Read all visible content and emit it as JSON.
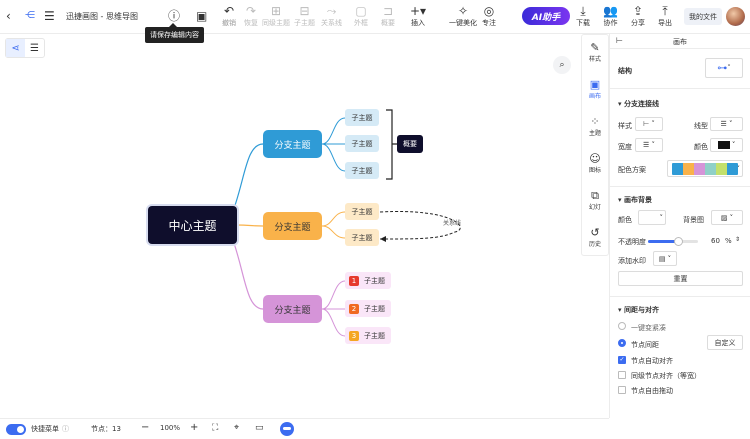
{
  "title": "迅捷画图 - 思维导图",
  "tooltip": "请保存编辑内容",
  "toolbar": {
    "undo": "撤销",
    "redo": "恢复",
    "sibling": "同级主题",
    "child": "子主题",
    "relation": "关系线",
    "frame": "外框",
    "summary": "概要",
    "insert": "插入",
    "beautify": "一键美化",
    "focus": "专注",
    "ai": "AI助手",
    "download": "下载",
    "collab": "协作",
    "share": "分享",
    "export": "导出",
    "my_files": "我的文件"
  },
  "mindmap": {
    "center": "中心主题",
    "branches": [
      {
        "label": "分支主题",
        "color": "#2f9bd6",
        "children": [
          "子主题",
          "子主题",
          "子主题"
        ]
      },
      {
        "label": "分支主题",
        "color": "#f9b24a",
        "children": [
          "子主题",
          "子主题"
        ]
      },
      {
        "label": "分支主题",
        "color": "#d594d8",
        "children": [
          "子主题",
          "子主题",
          "子主题"
        ]
      }
    ],
    "summary": "概要",
    "relation_label": "关系线",
    "numbers": [
      "1",
      "2",
      "3"
    ],
    "number_colors": [
      "#e63a2e",
      "#f06a22",
      "#f5a623"
    ]
  },
  "rail": {
    "style": "样式",
    "canvas": "画布",
    "theme": "主题",
    "icon": "图标",
    "slides": "幻灯",
    "history": "历史"
  },
  "panel": {
    "header": "画布",
    "structure_label": "结构",
    "branch_lines_title": "分支连接线",
    "line_style_label": "样式",
    "line_type_label": "线型",
    "width_label": "宽度",
    "color_label": "颜色",
    "color_scheme_label": "配色方案",
    "palette": [
      "#2f9bd6",
      "#f9b24a",
      "#d594d8",
      "#8fd0c7",
      "#c3e06b",
      "#2f9bd6"
    ],
    "background_title": "画布背景",
    "bg_color_label": "颜色",
    "bg_image_label": "背景图",
    "opacity_label": "不透明度",
    "opacity_value": "60",
    "opacity_unit": "%",
    "opacity_fraction": 0.6,
    "watermark_label": "添加水印",
    "reset_button": "重置",
    "spacing_title": "间距与对齐",
    "compact_option": "一键变紧凑",
    "node_spacing_option": "节点间距",
    "custom_button": "自定义",
    "auto_align": "节点自动对齐",
    "same_level_align": "同级节点对齐（等宽）",
    "free_drag": "节点自由拖动"
  },
  "bottom": {
    "quick_menu": "快捷菜单",
    "node_count": "节点：13",
    "zoom": "100%"
  }
}
